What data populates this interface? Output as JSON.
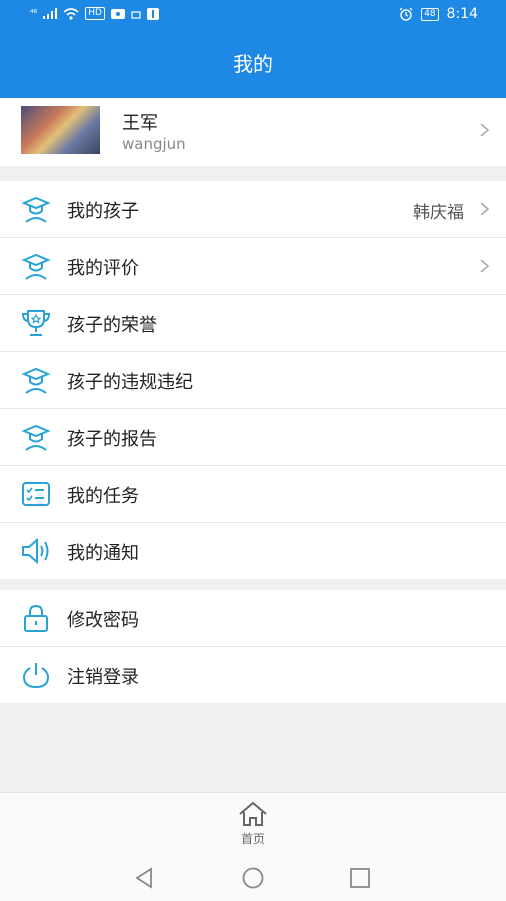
{
  "status_bar": {
    "network_label": "⁴⁶",
    "hd_label": "HD",
    "battery_level": "48",
    "time": "8:14"
  },
  "header": {
    "title": "我的"
  },
  "profile": {
    "name": "王军",
    "username": "wangjun"
  },
  "section1": {
    "items": [
      {
        "label": "我的孩子",
        "value": "韩庆福",
        "icon": "student-icon"
      },
      {
        "label": "我的评价",
        "value": "",
        "icon": "student-icon"
      },
      {
        "label": "孩子的荣誉",
        "value": "",
        "icon": "trophy-icon"
      },
      {
        "label": "孩子的违规违纪",
        "value": "",
        "icon": "student-icon"
      },
      {
        "label": "孩子的报告",
        "value": "",
        "icon": "student-icon"
      },
      {
        "label": "我的任务",
        "value": "",
        "icon": "tasklist-icon"
      },
      {
        "label": "我的通知",
        "value": "",
        "icon": "speaker-icon"
      }
    ]
  },
  "section2": {
    "items": [
      {
        "label": "修改密码",
        "icon": "lock-icon"
      },
      {
        "label": "注销登录",
        "icon": "power-icon"
      }
    ]
  },
  "bottom_nav": {
    "home_label": "首页"
  },
  "colors": {
    "primary": "#1e88e5",
    "icon": "#29a3d6"
  }
}
